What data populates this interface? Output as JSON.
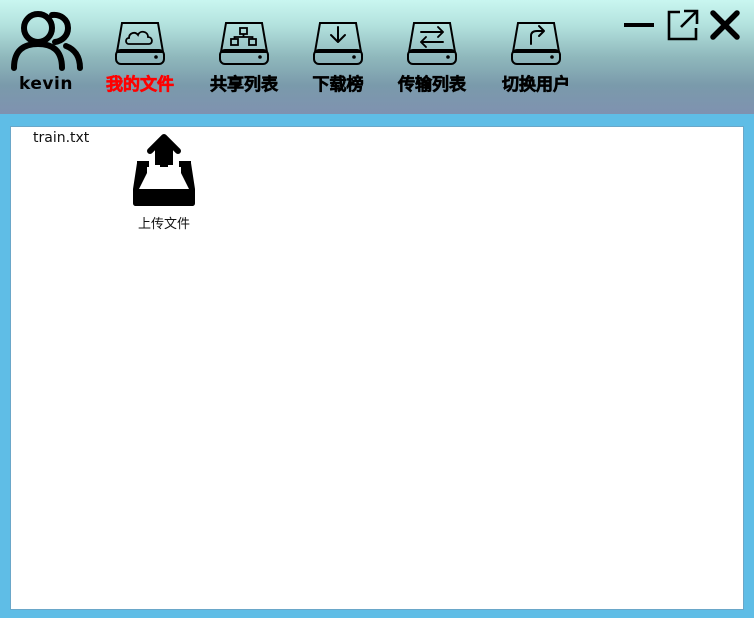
{
  "user": {
    "name": "kevin",
    "icon": "users-icon"
  },
  "nav": {
    "items": [
      {
        "label": "我的文件",
        "icon": "cloud-drive-icon",
        "active": true
      },
      {
        "label": "共享列表",
        "icon": "share-network-drive-icon",
        "active": false
      },
      {
        "label": "下载榜",
        "icon": "download-drive-icon",
        "active": false
      },
      {
        "label": "传输列表",
        "icon": "transfer-drive-icon",
        "active": false
      },
      {
        "label": "切换用户",
        "icon": "switch-user-drive-icon",
        "active": false
      }
    ],
    "active_color": "#ff0000"
  },
  "window_controls": {
    "minimize": "minimize-icon",
    "maximize": "external-link-icon",
    "close": "close-icon"
  },
  "files": [
    {
      "name": "train.txt"
    }
  ],
  "upload": {
    "label": "上传文件",
    "icon": "upload-tray-icon"
  },
  "colors": {
    "window_background": "#5fbde6",
    "content_background": "#ffffff"
  }
}
